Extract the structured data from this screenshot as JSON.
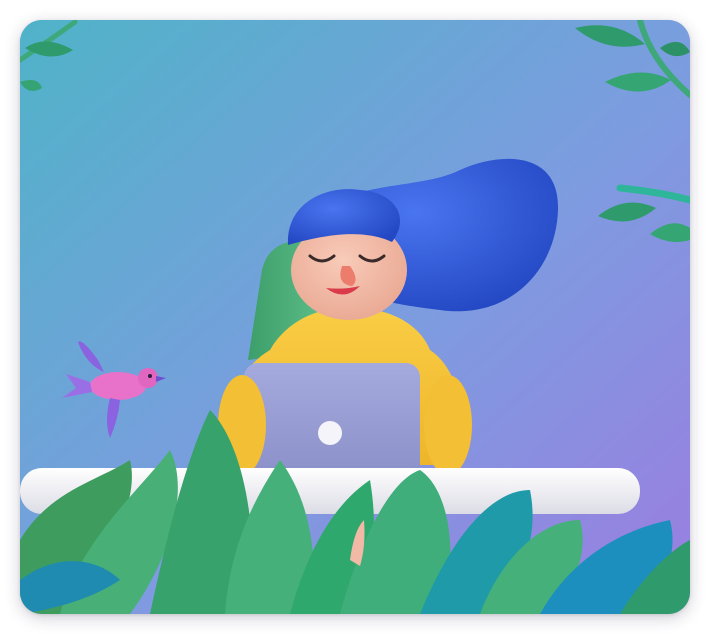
{
  "image": {
    "subject": "clay-illustration",
    "colors": {
      "bg_top_left": "#4fb3c8",
      "bg_bottom_right": "#9b7de0",
      "hair": "#2f57d6",
      "skin": "#f2b9a6",
      "sweater": "#f4c13a",
      "laptop": "#9a9fd4",
      "chair": "#4caa76",
      "desk": "#f3f3f6",
      "leaf_green": "#3ea87a",
      "leaf_teal": "#1f9aa8",
      "bird": "#e872c9"
    }
  }
}
